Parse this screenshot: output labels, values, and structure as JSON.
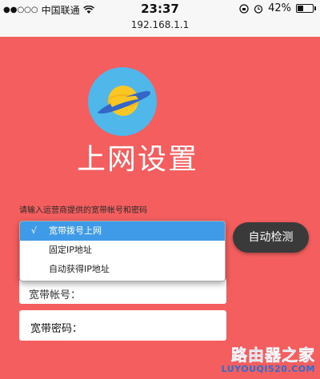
{
  "status_bar": {
    "signal_dots": "●●○○○",
    "carrier": "中国联通",
    "time": "23:37",
    "battery_percent": "42%",
    "battery_level": 0.42
  },
  "browser": {
    "url": "192.168.1.1"
  },
  "page": {
    "title": "上网设置",
    "hint": "请输入运营商提供的宽带帐号和密码",
    "connection_type_options": [
      {
        "label": "宽带拨号上网",
        "selected": true,
        "check": "√"
      },
      {
        "label": "固定IP地址",
        "selected": false
      },
      {
        "label": "自动获得IP地址",
        "selected": false
      }
    ],
    "auto_detect_label": "自动检测",
    "account_label": "宽带帐号：",
    "password_label": "宽带密码：",
    "colors": {
      "background": "#f45e5e",
      "logo_circle": "#4fb7ea",
      "planet": "#f9c623",
      "ring": "#3466c8",
      "selected_option": "#3f9ae8",
      "detect_button": "#3a3a3a"
    }
  },
  "watermark": {
    "main": "路由器之家",
    "sub": "LUYOUQI520.COM"
  }
}
